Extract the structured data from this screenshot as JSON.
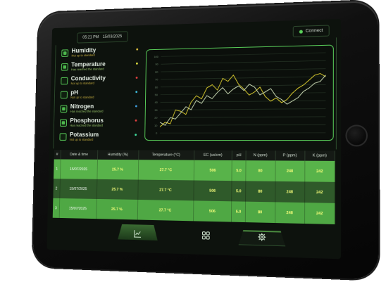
{
  "header": {
    "time": "05:21 PM",
    "date": "15/03/2025",
    "connect_label": "Connect",
    "connect_status_color": "#5ad05a"
  },
  "metrics": [
    {
      "name": "Humidity",
      "status": "Not up to standard",
      "checked": true,
      "dot": "#e0c040"
    },
    {
      "name": "Temperature",
      "status": "Has reached the standard",
      "checked": true,
      "dot": "#e0e040"
    },
    {
      "name": "Conductivity",
      "status": "Not up to standard",
      "checked": false,
      "dot": "#e04040"
    },
    {
      "name": "pH",
      "status": "Not up to standard",
      "checked": false,
      "dot": "#40c0e0"
    },
    {
      "name": "Nitrogen",
      "status": "Has reached the standard",
      "checked": true,
      "dot": "#40a0e0"
    },
    {
      "name": "Phosphorus",
      "status": "Has reached the standard",
      "checked": true,
      "dot": "#e04040"
    },
    {
      "name": "Potassium",
      "status": "Not up to standard",
      "checked": false,
      "dot": "#40e0a0"
    }
  ],
  "chart_data": {
    "type": "line",
    "title": "",
    "xlabel": "",
    "ylabel": "",
    "ylim": [
      0,
      100
    ],
    "yticks": [
      0,
      10,
      20,
      30,
      40,
      50,
      60,
      70,
      80,
      90,
      100
    ],
    "grid": true,
    "series": [
      {
        "color": "#e8d830",
        "values": [
          8,
          14,
          12,
          30,
          28,
          24,
          40,
          48,
          44,
          58,
          62,
          55,
          70,
          66,
          74,
          62,
          56,
          48,
          52,
          58,
          46,
          40,
          44,
          38,
          42,
          50,
          56,
          60,
          66,
          72,
          74,
          70
        ]
      },
      {
        "color": "#d8e8c0",
        "values": [
          14,
          10,
          20,
          18,
          26,
          34,
          30,
          42,
          38,
          48,
          44,
          52,
          58,
          50,
          56,
          60,
          54,
          62,
          58,
          48,
          52,
          56,
          46,
          42,
          36,
          40,
          44,
          52,
          56,
          62,
          64,
          72
        ]
      }
    ]
  },
  "table": {
    "headers": [
      "#",
      "Date & time",
      "Humidity (%)",
      "Temperature (°C)",
      "EC (us/cm)",
      "pH",
      "N (ppm)",
      "P (ppm)",
      "K (ppm)"
    ],
    "rows": [
      [
        "1",
        "15/07/2025",
        "25.7 %",
        "27.7 °C",
        "506",
        "5.0",
        "80",
        "248",
        "242"
      ],
      [
        "2",
        "15/07/2025",
        "25.7 %",
        "27.7 °C",
        "506",
        "5.0",
        "80",
        "248",
        "242"
      ],
      [
        "3",
        "15/07/2025",
        "25.7 %",
        "27.7 °C",
        "506",
        "5.0",
        "80",
        "248",
        "242"
      ]
    ]
  },
  "nav": [
    {
      "icon": "chart-icon",
      "active": true
    },
    {
      "icon": "grid-icon",
      "active": false
    },
    {
      "icon": "gear-icon",
      "active": false
    }
  ]
}
